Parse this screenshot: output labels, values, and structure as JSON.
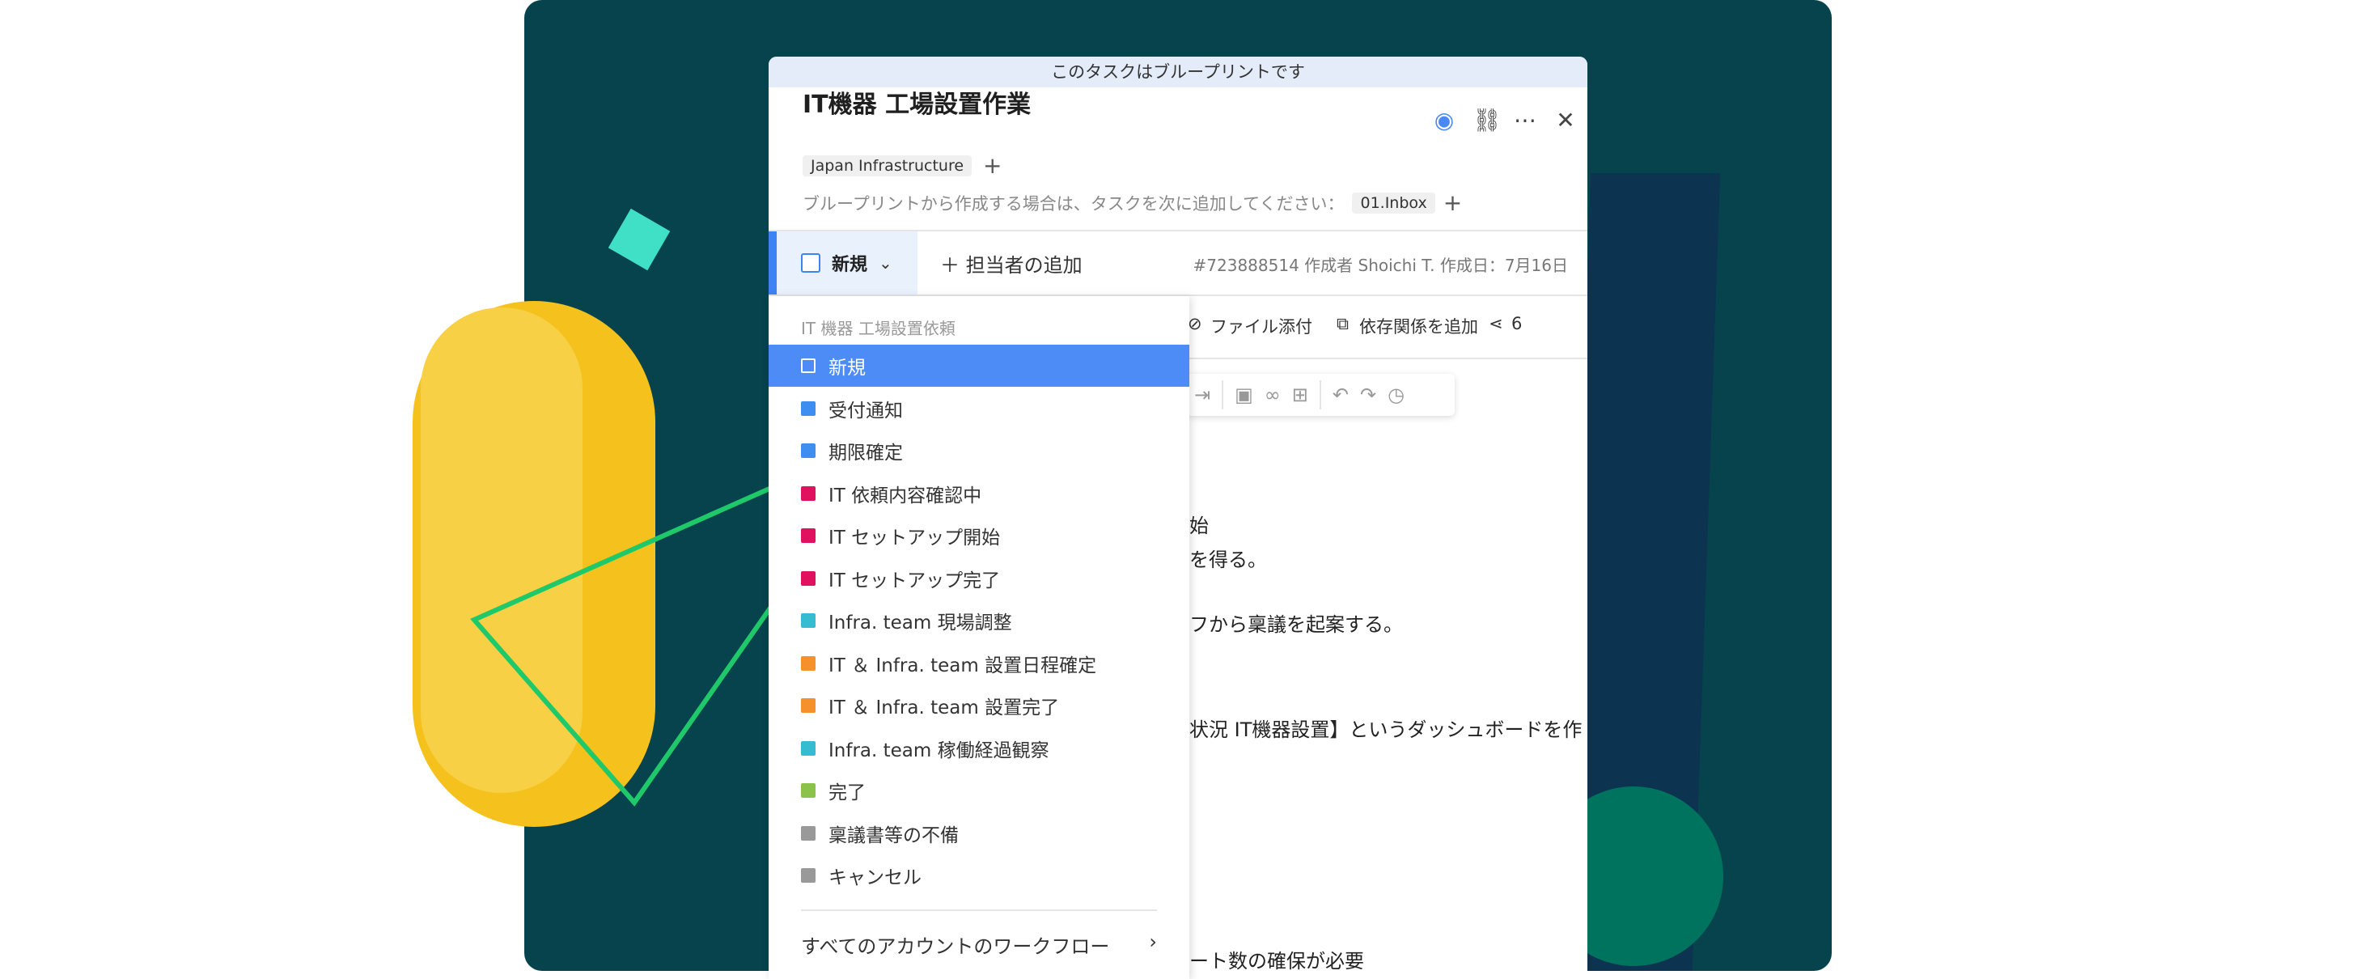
{
  "banner": "このタスクはブループリントです",
  "task": {
    "title": "IT機器 工場設置作業",
    "tag": "Japan Infrastructure",
    "blueprint_note": "ブループリントから作成する場合は、タスクを次に追加してください：",
    "blueprint_folder": "01.Inbox",
    "status_label": "新規",
    "assign_label": "＋ 担当者の追加",
    "meta": "#723888514  作成者 Shoichi T. 作成日：7月16日"
  },
  "toolbar2": {
    "attach": "ファイル添付",
    "dependency": "依存関係を追加",
    "share_count": "6"
  },
  "body_lines": [
    "始",
    "を得る。",
    "フから稟議を起案する。",
    "状況 IT機器設置】というダッシュボードを作",
    "ート数の確保が必要"
  ],
  "dropdown": {
    "header": "IT 機器 工場設置依頼",
    "items": [
      {
        "label": "新規",
        "color": "#ffffff",
        "selected": true
      },
      {
        "label": "受付通知",
        "color": "#3d8ef0"
      },
      {
        "label": "期限確定",
        "color": "#3d8ef0"
      },
      {
        "label": "IT 依頼内容確認中",
        "color": "#e0115f"
      },
      {
        "label": "IT セットアップ開始",
        "color": "#e0115f"
      },
      {
        "label": "IT セットアップ完了",
        "color": "#e0115f"
      },
      {
        "label": "Infra. team 現場調整",
        "color": "#35bcd0"
      },
      {
        "label": "IT ＆ Infra. team 設置日程確定",
        "color": "#f5902a"
      },
      {
        "label": "IT ＆ Infra. team 設置完了",
        "color": "#f5902a"
      },
      {
        "label": "Infra. team 稼働経過観察",
        "color": "#35bcd0"
      },
      {
        "label": "完了",
        "color": "#8bc34a"
      },
      {
        "label": "稟議書等の不備",
        "color": "#999999"
      },
      {
        "label": "キャンセル",
        "color": "#999999"
      }
    ],
    "footer": "すべてのアカウントのワークフロー",
    "footer_chevron": "›"
  }
}
